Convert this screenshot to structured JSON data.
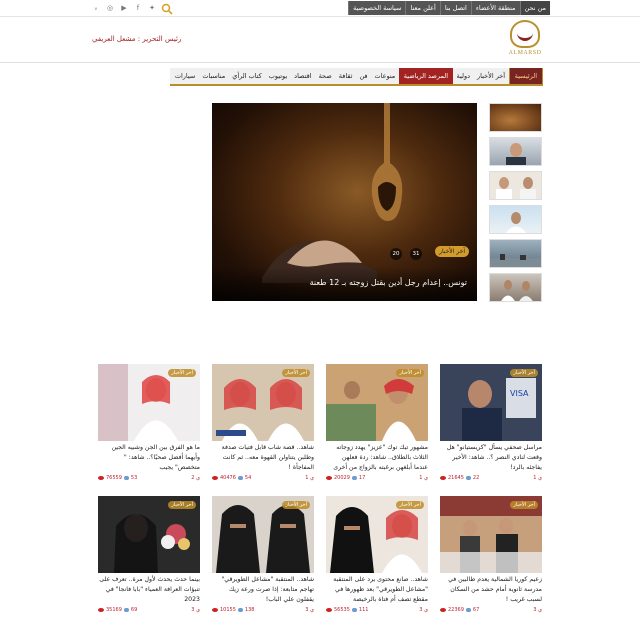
{
  "top_links": [
    "من نحن",
    "منطقة الأعضاء",
    "اتصل بنا",
    "أعلن معنا",
    "سياسة الخصوصية"
  ],
  "social_icons": [
    "vk-icon",
    "instagram-icon",
    "youtube-icon",
    "facebook-icon",
    "twitter-icon"
  ],
  "logo": {
    "text": "ALMARSD"
  },
  "editor": "رئيس التحرير : مشعل العريفي",
  "nav": {
    "items": [
      "الرئيسية",
      "آخر الأخبار",
      "دولية",
      "المرصد الرياضية",
      "منوعات",
      "فن",
      "ثقافة",
      "صحة",
      "اقتصاد",
      "يوتيوب",
      "كتاب الرأي",
      "مناسبات",
      "سيارات"
    ]
  },
  "hero": {
    "badge": "آخر الأخبار",
    "title": "تونس.. إعدام رجل أدين بقتل زوجته بـ 12 طعنة",
    "meta": [
      "31",
      "20"
    ]
  },
  "cards": [
    {
      "tag": "آخر الأخبار",
      "title": "مراسل صحفي يسأل \"كريستيانو\" هل وقعت لنادي النصر ؟.. شاهد: الأخير يفاجئه بالرد!",
      "views": "21645",
      "comments": "22",
      "age": "1 ي"
    },
    {
      "tag": "آخر الأخبار",
      "title": "مشهور تيك توك \"عزيز\" يهدد زوجاته الثلاث بالطلاق.. شاهد: ردة فعلهن عندما أبلغهن برغبته بالزواج من أخرى",
      "views": "20029",
      "comments": "17",
      "age": "1 ي"
    },
    {
      "tag": "آخر الأخبار",
      "title": "شاهد.. قصة شاب قابل فتيات صدفة وطلبن يتناولن القهوة معه.. ثم كانت المفاجأة !",
      "views": "40476",
      "comments": "54",
      "age": "1 ي"
    },
    {
      "tag": "آخر الأخبار",
      "title": "ما هو الفرق بين الجن وشبيه الجين وأيهما أفضل صحيًا؟.. شاهد: \" متخصص\" يجيب",
      "views": "76559",
      "comments": "53",
      "age": "2 ي"
    },
    {
      "tag": "آخر الأخبار",
      "title": "زعيم كوريا الشمالية يعدم طالبين في مدرسة ثانوية أمام حشد من السكان لسبب غريب !",
      "views": "22369",
      "comments": "67",
      "age": "3 ي"
    },
    {
      "tag": "آخر الأخبار",
      "title": "شاهد.. صانع محتوى يرد على المنتقبة \"مشاعل الطويرقي\" بعد ظهورها في مقطع تصف أم فتاة بالرخيصة",
      "views": "56535",
      "comments": "111",
      "age": "3 ي"
    },
    {
      "tag": "آخر الأخبار",
      "title": "شاهد.. المنتقبة \"مشاعل الطويرقي\" تهاجم متابعة: إذا صرت ورعة زيك يقفلون علي الباب!",
      "views": "10155",
      "comments": "138",
      "age": "3 ي"
    },
    {
      "tag": "آخر الأخبار",
      "title": "بينما حدث يحدث لأول مرة.. تعرف على تنبؤات العرافة العمياء \"بابا فانجا\" في 2023",
      "views": "35169",
      "comments": "69",
      "age": "3 ي"
    }
  ],
  "colors": {
    "accent": "#b88e2c",
    "brand_red": "#a32323",
    "nav_bg": "#f0f0f0"
  }
}
